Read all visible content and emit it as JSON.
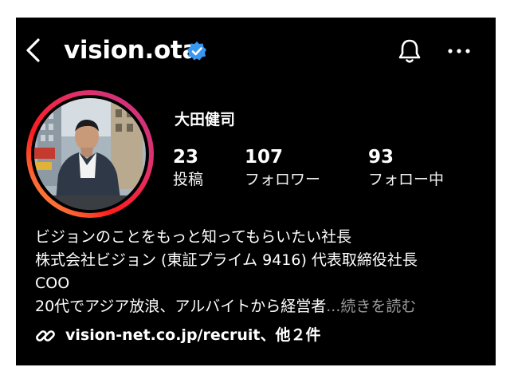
{
  "header": {
    "username": "vision.ota",
    "verified_color": "#3897f0",
    "back_icon": "chevron-left-icon",
    "notification_icon": "bell-icon",
    "more_icon": "more-horizontal-icon"
  },
  "profile": {
    "name": "大田健司",
    "story_ring_colors": [
      "#fcaf45",
      "#fd1d1d",
      "#e1306c",
      "#c13584"
    ],
    "stats": [
      {
        "value": "23",
        "label": "投稿"
      },
      {
        "value": "107",
        "label": "フォロワー"
      },
      {
        "value": "93",
        "label": "フォロー中"
      }
    ],
    "bio": {
      "line1": "ビジョンのことをもっと知ってもらいたい社長",
      "line2": "株式会社ビジョン (東証プライム 9416) 代表取締役社長",
      "line3": "COO",
      "line4": "20代でアジア放浪、アルバイトから経営者",
      "ellipsis": "...",
      "more_label": "続きを読む"
    },
    "link": {
      "icon": "link-icon",
      "text": "vision-net.co.jp/recruit、他２件"
    }
  }
}
